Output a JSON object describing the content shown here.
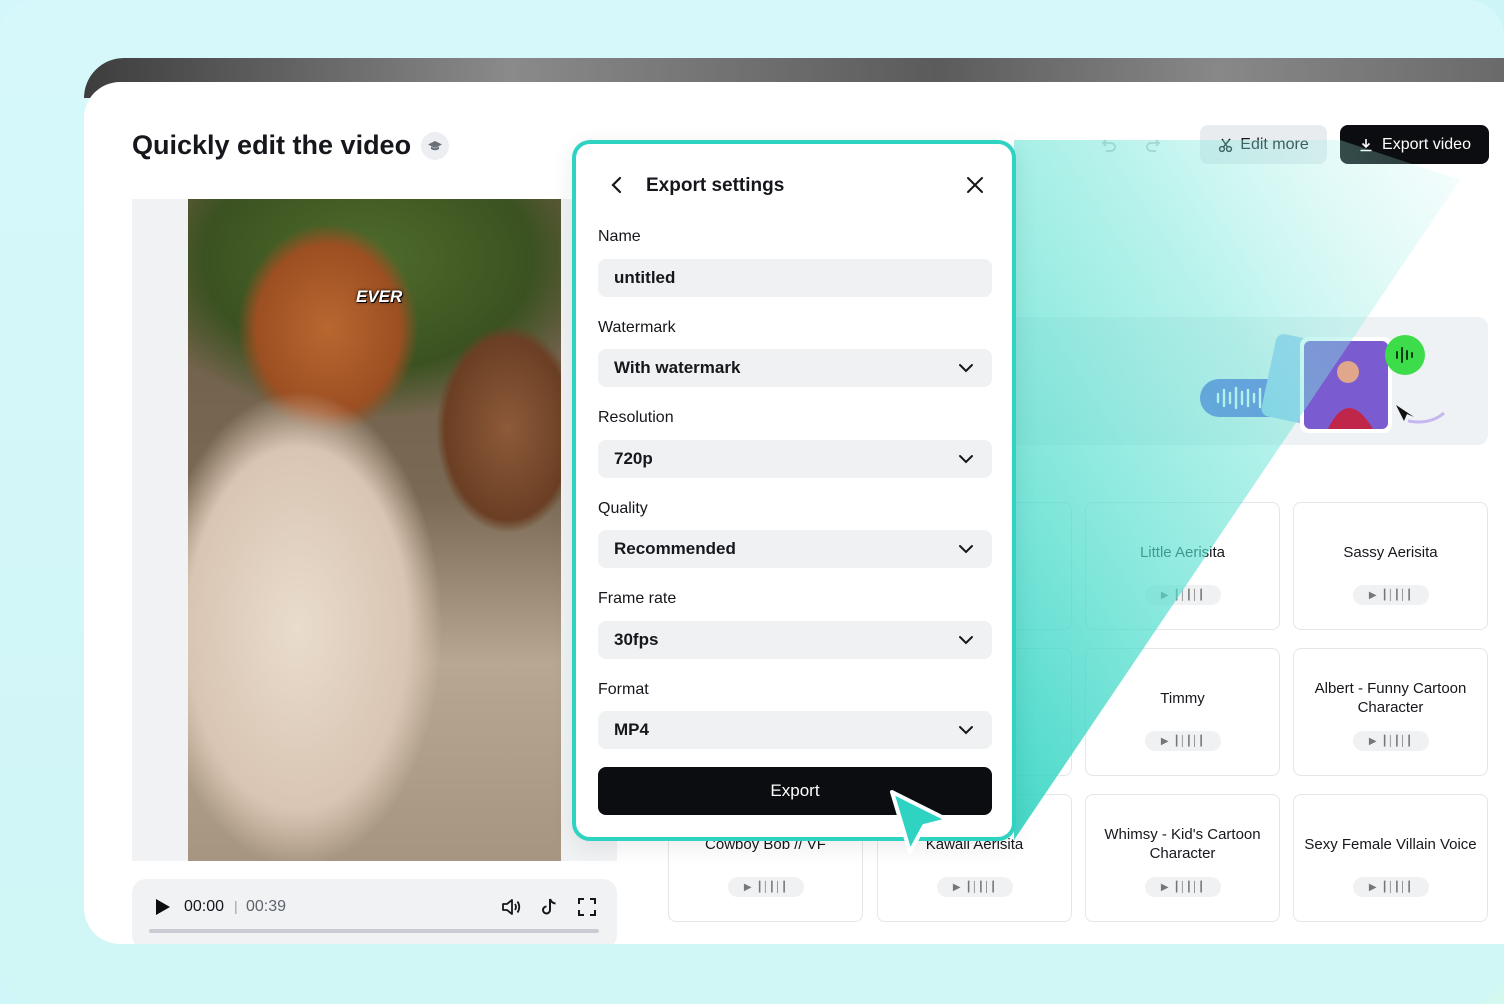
{
  "page": {
    "title": "Quickly edit the video"
  },
  "video": {
    "caption": "EVER",
    "time_current": "00:00",
    "time_separator": "|",
    "time_total": "00:39"
  },
  "toolbar": {
    "edit_more_label": "Edit more",
    "export_video_label": "Export video"
  },
  "voices": [
    {
      "name": "Little Aerisita"
    },
    {
      "name": "Sassy Aerisita"
    },
    {
      "name": "Timmy"
    },
    {
      "name": "Albert - Funny Cartoon Character"
    },
    {
      "name": "Cowboy Bob // VF"
    },
    {
      "name": "Kawaii Aerisita"
    },
    {
      "name": "Whimsy - Kid's Cartoon Character"
    },
    {
      "name": "Sexy Female Villain Voice"
    }
  ],
  "dialog": {
    "title": "Export settings",
    "name_label": "Name",
    "name_value": "untitled",
    "watermark_label": "Watermark",
    "watermark_value": "With watermark",
    "resolution_label": "Resolution",
    "resolution_value": "720p",
    "quality_label": "Quality",
    "quality_value": "Recommended",
    "framerate_label": "Frame rate",
    "framerate_value": "30fps",
    "format_label": "Format",
    "format_value": "MP4",
    "export_label": "Export"
  },
  "colors": {
    "accent": "#2fd3c1",
    "primary_button": "#0b0d10",
    "waveform_pill": "#5b5fe0",
    "mic_badge": "#3ddc4a"
  }
}
